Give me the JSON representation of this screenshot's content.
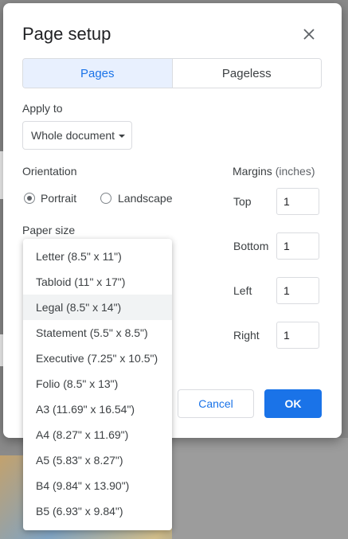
{
  "dialog": {
    "title": "Page setup",
    "close_icon": "close-icon"
  },
  "mode_tabs": [
    {
      "label": "Pages",
      "active": true
    },
    {
      "label": "Pageless",
      "active": false
    }
  ],
  "apply_to": {
    "label": "Apply to",
    "value": "Whole document"
  },
  "orientation": {
    "label": "Orientation",
    "options": [
      {
        "label": "Portrait",
        "checked": true
      },
      {
        "label": "Landscape",
        "checked": false
      }
    ]
  },
  "paper_size": {
    "label": "Paper size",
    "options": [
      "Letter (8.5\" x 11\")",
      "Tabloid (11\" x 17\")",
      "Legal (8.5\" x 14\")",
      "Statement (5.5\" x 8.5\")",
      "Executive (7.25\" x 10.5\")",
      "Folio (8.5\" x 13\")",
      "A3 (11.69\" x 16.54\")",
      "A4 (8.27\" x 11.69\")",
      "A5 (5.83\" x 8.27\")",
      "B4 (9.84\" x 13.90\")",
      "B5 (6.93\" x 9.84\")"
    ],
    "highlighted": "Legal (8.5\" x 14\")"
  },
  "margins": {
    "label": "Margins",
    "unit": "(inches)",
    "fields": [
      {
        "label": "Top",
        "value": "1"
      },
      {
        "label": "Bottom",
        "value": "1"
      },
      {
        "label": "Left",
        "value": "1"
      },
      {
        "label": "Right",
        "value": "1"
      }
    ]
  },
  "actions": {
    "cancel": "Cancel",
    "ok": "OK"
  },
  "colors": {
    "accent": "#1a73e8",
    "active_tab_bg": "#e8f0fe"
  }
}
